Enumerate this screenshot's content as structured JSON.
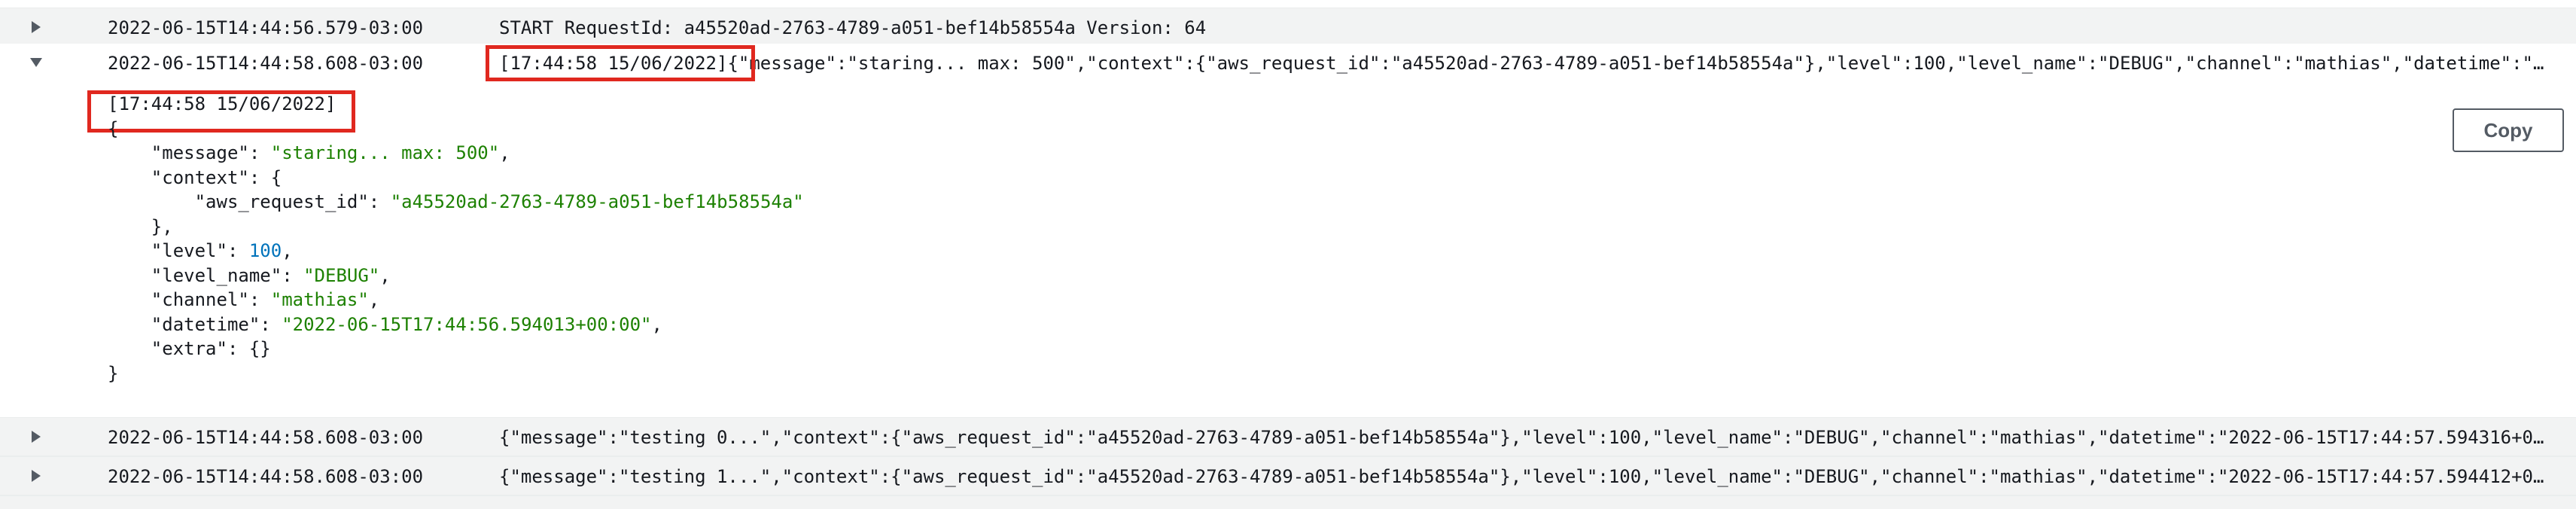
{
  "rows": [
    {
      "timestamp": "2022-06-15T14:44:56.579-03:00",
      "message": "START RequestId: a45520ad-2763-4789-a051-bef14b58554a Version: 64",
      "expanded": false
    },
    {
      "timestamp": "2022-06-15T14:44:58.608-03:00",
      "prefix": "[17:44:58 15/06/2022]",
      "message": "{\"message\":\"staring... max: 500\",\"context\":{\"aws_request_id\":\"a45520ad-2763-4789-a051-bef14b58554a\"},\"level\":100,\"level_name\":\"DEBUG\",\"channel\":\"mathias\",\"datetime\":\"2…",
      "expanded": true
    },
    {
      "timestamp": "2022-06-15T14:44:58.608-03:00",
      "message": "{\"message\":\"testing 0...\",\"context\":{\"aws_request_id\":\"a45520ad-2763-4789-a051-bef14b58554a\"},\"level\":100,\"level_name\":\"DEBUG\",\"channel\":\"mathias\",\"datetime\":\"2022-06-15T17:44:57.594316+00…",
      "expanded": false
    },
    {
      "timestamp": "2022-06-15T14:44:58.608-03:00",
      "message": "{\"message\":\"testing 1...\",\"context\":{\"aws_request_id\":\"a45520ad-2763-4789-a051-bef14b58554a\"},\"level\":100,\"level_name\":\"DEBUG\",\"channel\":\"mathias\",\"datetime\":\"2022-06-15T17:44:57.594412+00…",
      "expanded": false
    }
  ],
  "detail": {
    "prefix": "[17:44:58 15/06/2022]",
    "open_brace": "{",
    "message_key": "\"message\": ",
    "message_val": "\"staring... max: 500\"",
    "context_key": "\"context\": {",
    "aws_request_id_key": "\"aws_request_id\": ",
    "aws_request_id_val": "\"a45520ad-2763-4789-a051-bef14b58554a\"",
    "context_close": "},",
    "level_key": "\"level\": ",
    "level_val": "100",
    "level_name_key": "\"level_name\": ",
    "level_name_val": "\"DEBUG\"",
    "channel_key": "\"channel\": ",
    "channel_val": "\"mathias\"",
    "datetime_key": "\"datetime\": ",
    "datetime_val": "\"2022-06-15T17:44:56.594013+00:00\"",
    "extra_key": "\"extra\": ",
    "extra_val": "{}",
    "close_brace": "}",
    "comma": ","
  },
  "copy_button": {
    "label": "Copy"
  },
  "colors": {
    "row_bg": "#f2f3f3",
    "string": "#1d8102",
    "number": "#0073bb",
    "highlight": "#e0281f"
  },
  "icons": {
    "collapsed": "caret-right-icon",
    "expanded": "caret-down-icon"
  }
}
